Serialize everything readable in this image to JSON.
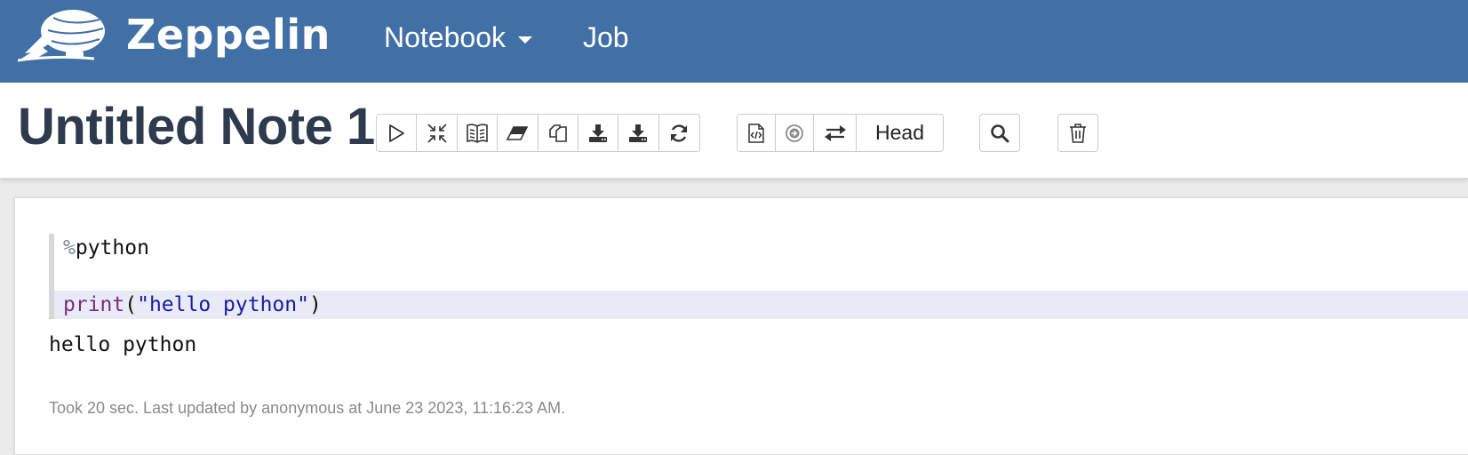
{
  "app": {
    "brand_name": "Zeppelin"
  },
  "navbar": {
    "notebook_label": "Notebook",
    "job_label": "Job"
  },
  "note": {
    "title": "Untitled Note 1",
    "toolbar": {
      "icons": [
        "run-all-icon",
        "collapse-icon",
        "book-icon",
        "eraser-icon",
        "clone-icon",
        "export-icon",
        "export-alt-icon",
        "reload-icon"
      ],
      "code_icons": [
        "code-file-icon",
        "circle-arrow-icon",
        "swap-icon"
      ],
      "head_label": "Head",
      "search_icon": "search-icon",
      "trash_icon": "trash-icon"
    }
  },
  "paragraph": {
    "code_lines": [
      {
        "percent": "%",
        "text": "python"
      },
      {
        "text": ""
      },
      {
        "keyword": "print",
        "open": "(",
        "string": "\"hello python\"",
        "close": ")"
      }
    ],
    "output": "hello python",
    "status": "Took 20 sec. Last updated by anonymous at June 23 2023, 11:16:23 AM."
  },
  "colors": {
    "navbar": "#4070a6",
    "title": "#2e3b4e",
    "keyword": "#7a2d82",
    "string": "#1a1aa6",
    "active_line": "#e8eaf6"
  }
}
